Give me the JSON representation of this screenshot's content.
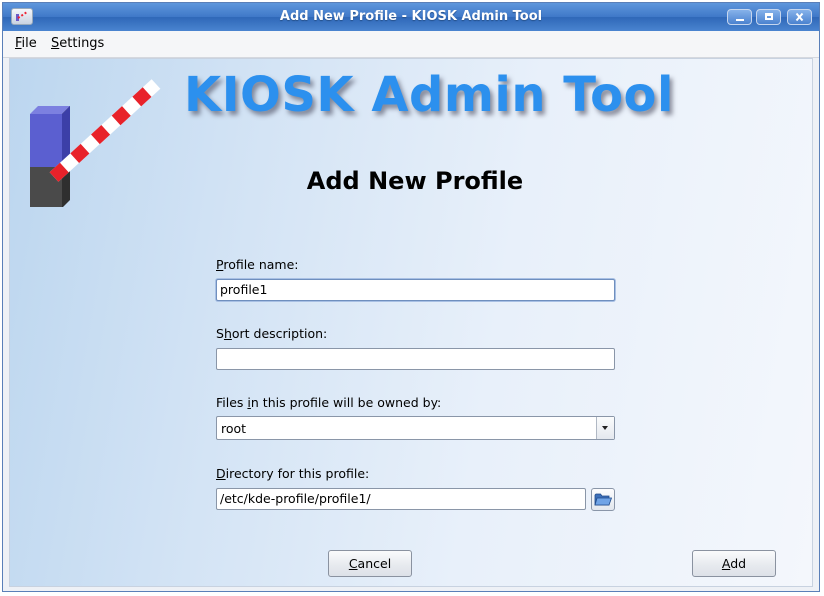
{
  "window": {
    "title": "Add New Profile - KIOSK Admin Tool",
    "controls": {
      "minimize": "minimize",
      "maximize": "maximize",
      "close": "close"
    }
  },
  "menu": {
    "file": {
      "mnemonic": "F",
      "rest": "ile"
    },
    "settings": {
      "mnemonic": "S",
      "rest": "ettings"
    }
  },
  "banner": {
    "text": "KIOSK Admin Tool"
  },
  "heading": "Add New Profile",
  "form": {
    "profile_name": {
      "label_mnemonic": "P",
      "label_rest": "rofile name:",
      "value": "profile1"
    },
    "short_description": {
      "label_start": "S",
      "label_mnemonic": "h",
      "label_rest": "ort description:",
      "value": ""
    },
    "owner": {
      "label_start": "Files ",
      "label_mnemonic": "i",
      "label_rest": "n this profile will be owned by:",
      "value": "root"
    },
    "directory": {
      "label_mnemonic": "D",
      "label_rest": "irectory for this profile:",
      "value": "/etc/kde-profile/profile1/"
    }
  },
  "buttons": {
    "cancel": {
      "mnemonic": "C",
      "rest": "ancel"
    },
    "add": {
      "mnemonic": "A",
      "rest": "dd"
    }
  },
  "colors": {
    "titlebar": "#3f78c8",
    "banner_text": "#2c90ee",
    "barrier_red": "#e8222a",
    "barrier_post_top": "#5a5fc8",
    "barrier_post_bottom": "#444444"
  },
  "icons": {
    "app": "kiosk-app-icon",
    "logo": "barrier-logo-icon",
    "browse": "folder-open-icon",
    "dropdown": "chevron-down-icon"
  }
}
